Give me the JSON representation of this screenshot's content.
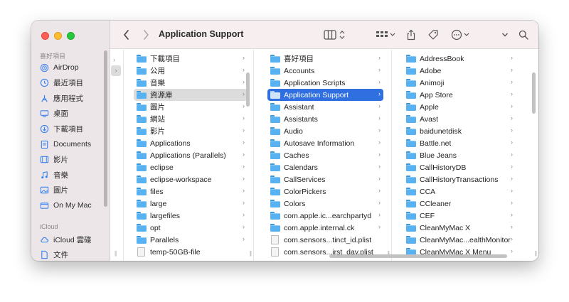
{
  "window": {
    "title": "Application Support"
  },
  "sidebar": {
    "sections": [
      {
        "title": "喜好項目",
        "items": [
          {
            "label": "AirDrop",
            "icon": "airdrop-icon"
          },
          {
            "label": "最近項目",
            "icon": "clock-icon"
          },
          {
            "label": "應用程式",
            "icon": "applications-icon"
          },
          {
            "label": "桌面",
            "icon": "desktop-icon"
          },
          {
            "label": "下載項目",
            "icon": "download-icon"
          },
          {
            "label": "Documents",
            "icon": "document-icon"
          },
          {
            "label": "影片",
            "icon": "film-icon"
          },
          {
            "label": "音樂",
            "icon": "music-icon"
          },
          {
            "label": "圖片",
            "icon": "photo-icon"
          },
          {
            "label": "On My Mac",
            "icon": "folder-icon"
          }
        ]
      },
      {
        "title": "iCloud",
        "items": [
          {
            "label": "iCloud 雲碟",
            "icon": "cloud-icon"
          },
          {
            "label": "文件",
            "icon": "file-icon"
          }
        ]
      }
    ]
  },
  "columns": [
    {
      "items": [
        {
          "label": "下載項目",
          "type": "folder"
        },
        {
          "label": "公用",
          "type": "folder"
        },
        {
          "label": "音樂",
          "type": "folder"
        },
        {
          "label": "資源庫",
          "type": "folder",
          "selected": "gray"
        },
        {
          "label": "圖片",
          "type": "folder"
        },
        {
          "label": "網站",
          "type": "folder"
        },
        {
          "label": "影片",
          "type": "folder"
        },
        {
          "label": "Applications",
          "type": "folder"
        },
        {
          "label": "Applications (Parallels)",
          "type": "folder"
        },
        {
          "label": "eclipse",
          "type": "folder"
        },
        {
          "label": "eclipse-workspace",
          "type": "folder"
        },
        {
          "label": "files",
          "type": "folder"
        },
        {
          "label": "large",
          "type": "folder"
        },
        {
          "label": "largefiles",
          "type": "folder"
        },
        {
          "label": "opt",
          "type": "folder"
        },
        {
          "label": "Parallels",
          "type": "folder"
        },
        {
          "label": "temp-50GB-file",
          "type": "file"
        }
      ]
    },
    {
      "items": [
        {
          "label": "喜好項目",
          "type": "folder"
        },
        {
          "label": "Accounts",
          "type": "folder"
        },
        {
          "label": "Application Scripts",
          "type": "folder"
        },
        {
          "label": "Application Support",
          "type": "folder",
          "selected": "blue"
        },
        {
          "label": "Assistant",
          "type": "folder"
        },
        {
          "label": "Assistants",
          "type": "folder"
        },
        {
          "label": "Audio",
          "type": "folder"
        },
        {
          "label": "Autosave Information",
          "type": "folder"
        },
        {
          "label": "Caches",
          "type": "folder"
        },
        {
          "label": "Calendars",
          "type": "folder"
        },
        {
          "label": "CallServices",
          "type": "folder"
        },
        {
          "label": "ColorPickers",
          "type": "folder"
        },
        {
          "label": "Colors",
          "type": "folder"
        },
        {
          "label": "com.apple.ic...earchpartyd",
          "type": "folder"
        },
        {
          "label": "com.apple.internal.ck",
          "type": "folder"
        },
        {
          "label": "com.sensors...tinct_id.plist",
          "type": "file"
        },
        {
          "label": "com.sensors...irst_day.plist",
          "type": "file"
        }
      ]
    },
    {
      "items": [
        {
          "label": "AddressBook",
          "type": "folder"
        },
        {
          "label": "Adobe",
          "type": "folder"
        },
        {
          "label": "Animoji",
          "type": "folder"
        },
        {
          "label": "App Store",
          "type": "folder"
        },
        {
          "label": "Apple",
          "type": "folder"
        },
        {
          "label": "Avast",
          "type": "folder"
        },
        {
          "label": "baidunetdisk",
          "type": "folder"
        },
        {
          "label": "Battle.net",
          "type": "folder"
        },
        {
          "label": "Blue Jeans",
          "type": "folder"
        },
        {
          "label": "CallHistoryDB",
          "type": "folder"
        },
        {
          "label": "CallHistoryTransactions",
          "type": "folder"
        },
        {
          "label": "CCA",
          "type": "folder"
        },
        {
          "label": "CCleaner",
          "type": "folder"
        },
        {
          "label": "CEF",
          "type": "folder"
        },
        {
          "label": "CleanMyMac X",
          "type": "folder"
        },
        {
          "label": "CleanMyMac...ealthMonitor",
          "type": "folder"
        },
        {
          "label": "CleanMyMac X Menu",
          "type": "folder"
        }
      ]
    }
  ],
  "colors": {
    "selection_blue": "#2f6fe0",
    "sidebar_bg": "#ece6e8",
    "toolbar_bg": "#f6eeef",
    "folder_blue": "#58b1f0"
  }
}
